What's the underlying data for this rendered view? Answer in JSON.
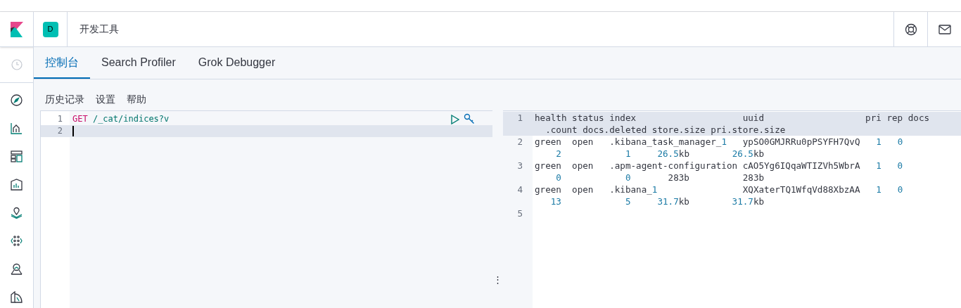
{
  "header": {
    "space_avatar": "D",
    "title": "开发工具"
  },
  "tabs": [
    {
      "label": "控制台",
      "selected": true
    },
    {
      "label": "Search Profiler",
      "selected": false
    },
    {
      "label": "Grok Debugger",
      "selected": false
    }
  ],
  "menu": [
    "历史记录",
    "设置",
    "帮助"
  ],
  "editor": {
    "lines": [
      {
        "number": "1",
        "current": false,
        "text": "GET /_cat/indices?v"
      },
      {
        "number": "2",
        "current": true
      }
    ]
  },
  "resize_handle": "⋮",
  "output": {
    "lines": [
      {
        "number": "1",
        "current": true,
        "rows": [
          "health status index                    uuid                   pri rep docs",
          "  .count docs.deleted store.size pri.store.size"
        ]
      },
      {
        "number": "2",
        "current": false,
        "rows": [
          "green  open   .kibana_task_manager_1   ypSO0GMJRRu0pPSYFH7QvQ   1   0",
          "    2            1     26.5kb        26.5kb"
        ]
      },
      {
        "number": "3",
        "current": false,
        "rows": [
          "green  open   .apm-agent-configuration cAO5Yg6IQqaWTIZVh5WbrA   1   0",
          "    0            0       283b          283b"
        ]
      },
      {
        "number": "4",
        "current": false,
        "rows": [
          "green  open   .kibana_1                XQXaterTQ1WfqVd88XbzAA   1   0",
          "   13            5     31.7kb        31.7kb"
        ]
      },
      {
        "number": "5",
        "current": false
      }
    ]
  }
}
